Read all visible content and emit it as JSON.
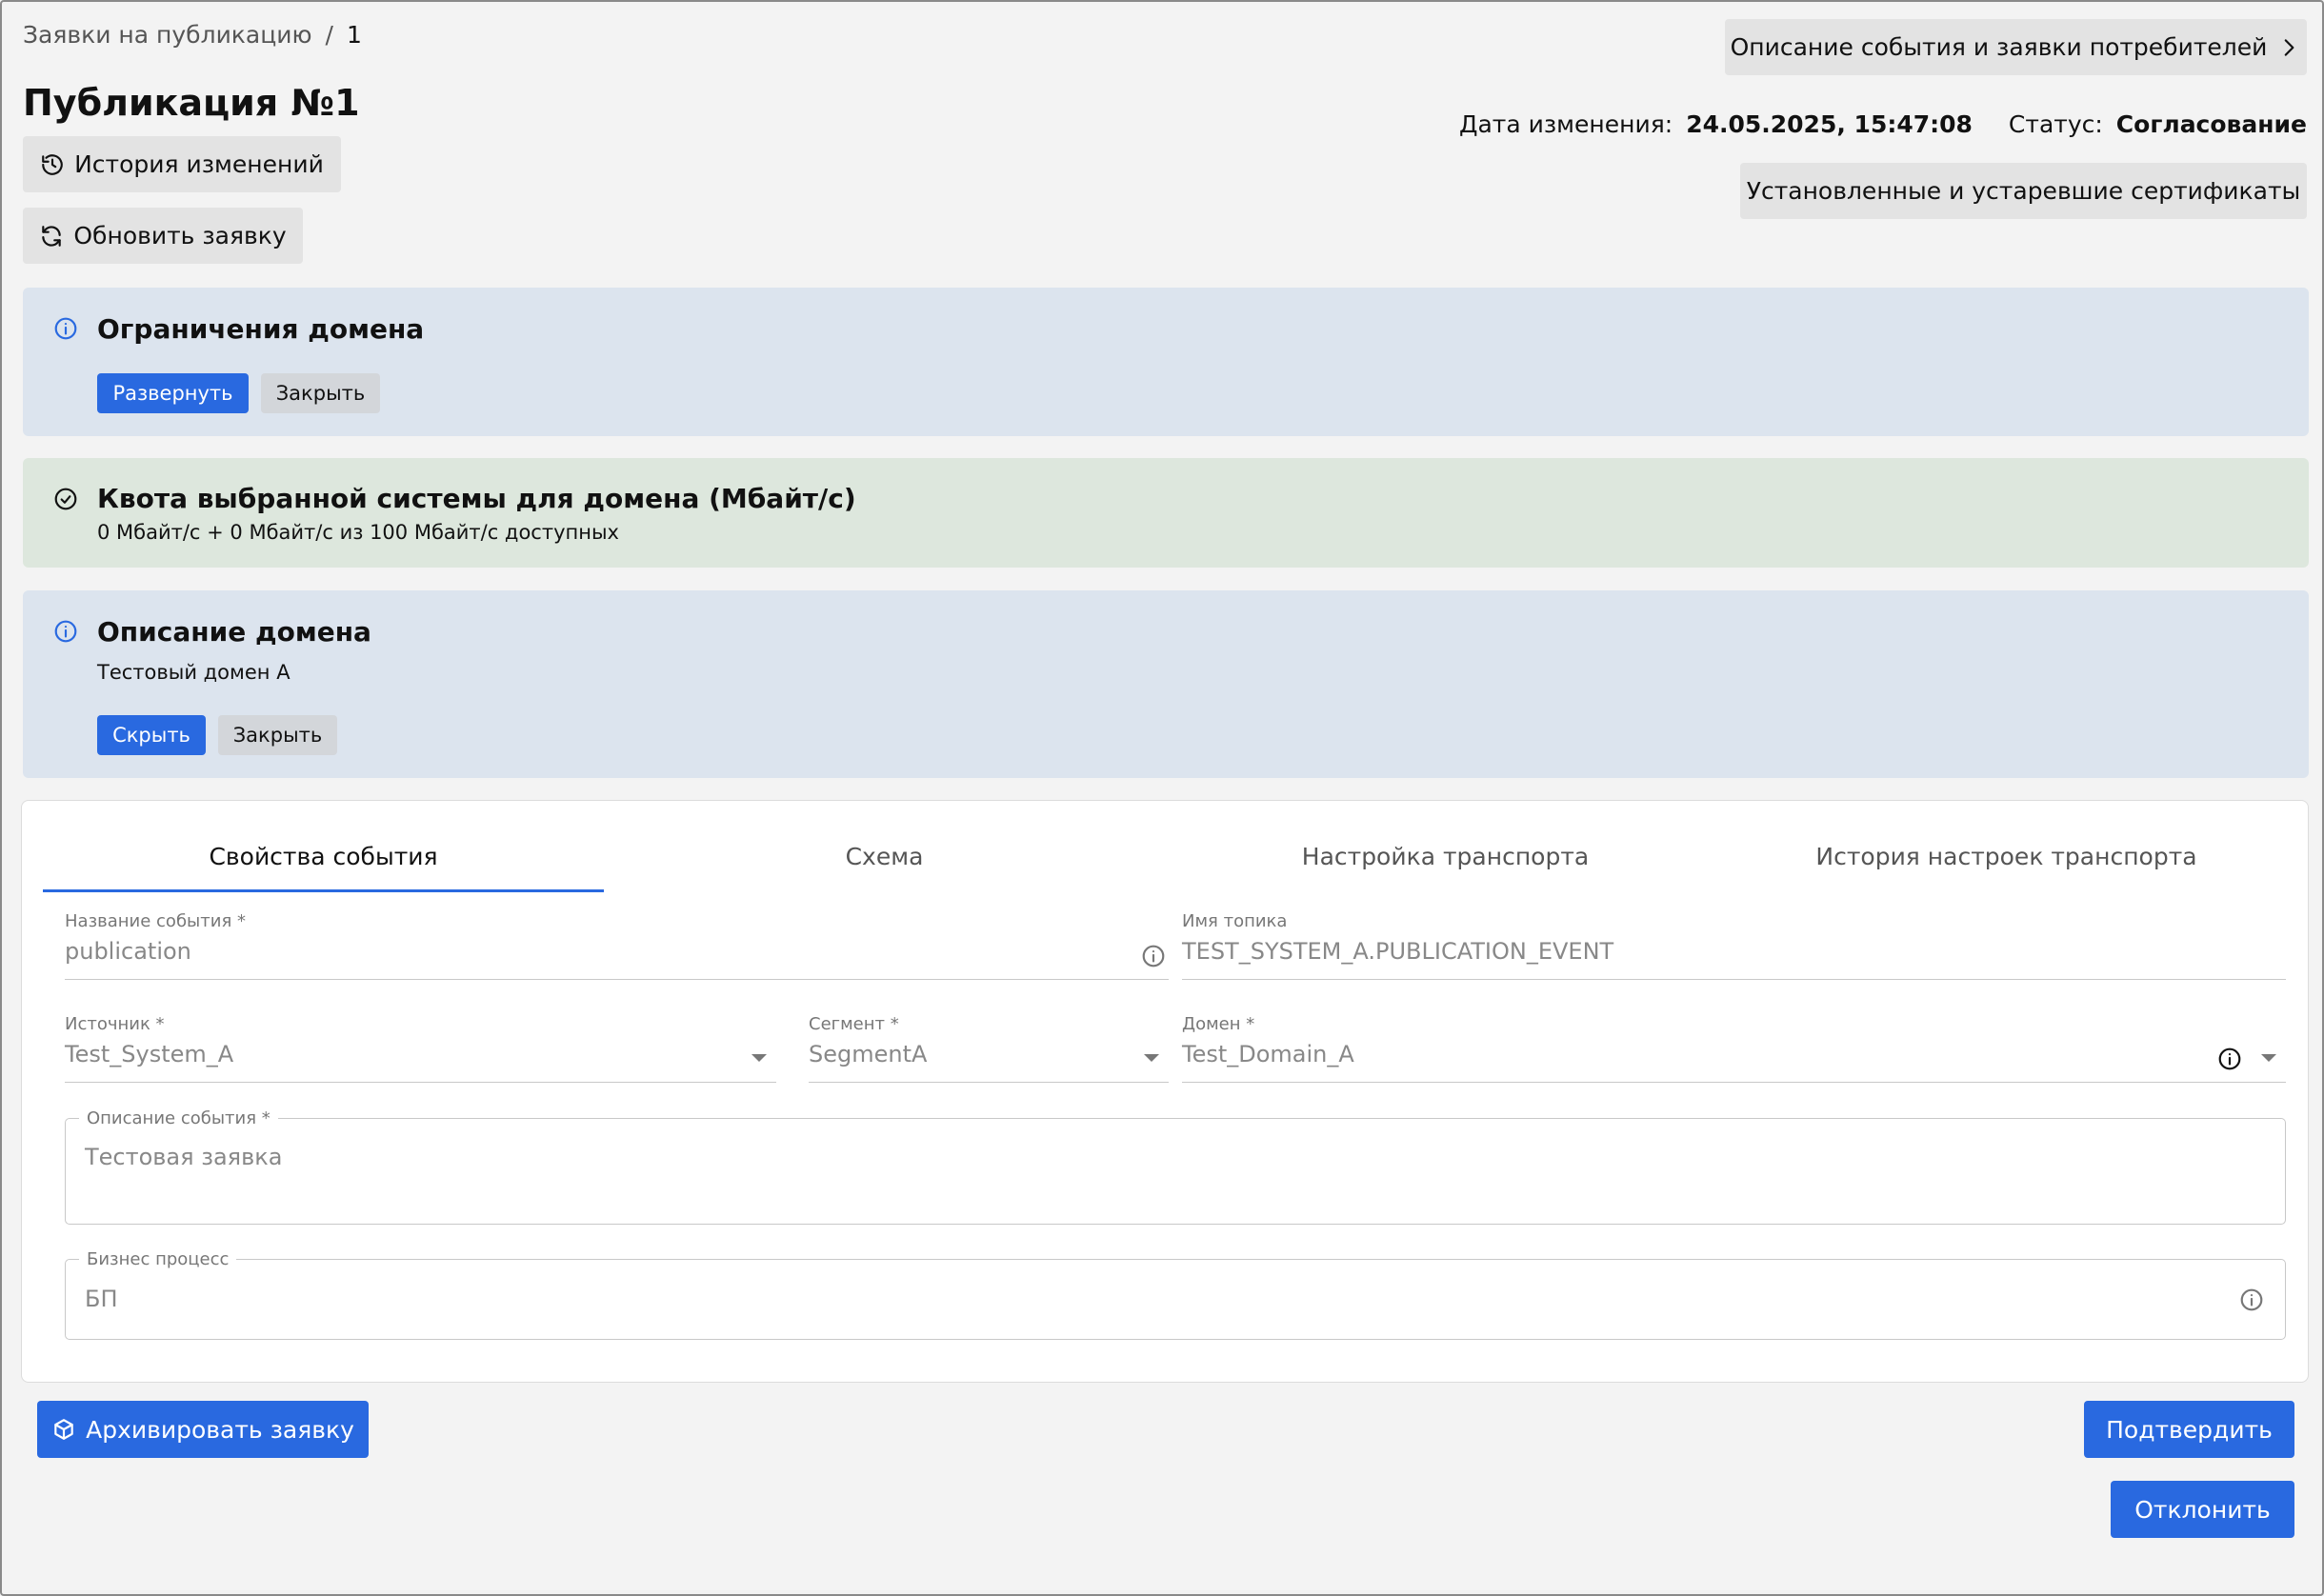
{
  "breadcrumb": {
    "parent": "Заявки на публикацию",
    "separator": "/",
    "current": "1"
  },
  "page": {
    "title": "Публикация №1"
  },
  "header_actions": {
    "history_label": "История изменений",
    "refresh_label": "Обновить заявку",
    "event_description_label": "Описание события и заявки потребителей",
    "certificates_label": "Установленные и устаревшие сертификаты"
  },
  "meta": {
    "modified_label": "Дата изменения:",
    "modified_value": "24.05.2025, 15:47:08",
    "status_label": "Статус:",
    "status_value": "Согласование"
  },
  "domain_restrictions": {
    "title": "Ограничения домена",
    "expand_label": "Развернуть",
    "close_label": "Закрыть"
  },
  "quota": {
    "title": "Квота выбранной системы для домена (Мбайт/с)",
    "text": "0 Мбайт/с + 0 Мбайт/с из 100 Мбайт/с доступных"
  },
  "domain_description": {
    "title": "Описание домена",
    "text": "Тестовый домен А",
    "hide_label": "Скрыть",
    "close_label": "Закрыть"
  },
  "tabs": [
    {
      "label": "Свойства события",
      "active": true
    },
    {
      "label": "Схема",
      "active": false
    },
    {
      "label": "Настройка транспорта",
      "active": false
    },
    {
      "label": "История настроек транспорта",
      "active": false
    }
  ],
  "form": {
    "event_name": {
      "label": "Название события *",
      "value": "publication"
    },
    "topic_name": {
      "label": "Имя топика",
      "value": "TEST_SYSTEM_A.PUBLICATION_EVENT"
    },
    "source": {
      "label": "Источник *",
      "value": "Test_System_A"
    },
    "segment": {
      "label": "Сегмент *",
      "value": "SegmentA"
    },
    "domain": {
      "label": "Домен *",
      "value": "Test_Domain_A"
    },
    "event_description": {
      "label": "Описание события *",
      "value": "Тестовая заявка"
    },
    "business_process": {
      "label": "Бизнес процесс",
      "value": "БП"
    }
  },
  "footer_actions": {
    "archive_label": "Архивировать заявку",
    "confirm_label": "Подтвердить",
    "reject_label": "Отклонить"
  },
  "colors": {
    "primary": "#2969e0",
    "info_panel": "#dce4ee",
    "success_panel": "#dde7dd",
    "page_bg": "#f3f3f3"
  },
  "icons": {
    "history": "history-icon",
    "refresh": "refresh-icon",
    "chevron": "chevron-right-icon",
    "info": "info-icon",
    "check": "check-circle-icon",
    "archive": "archive-box-icon",
    "caret": "caret-down-icon"
  }
}
